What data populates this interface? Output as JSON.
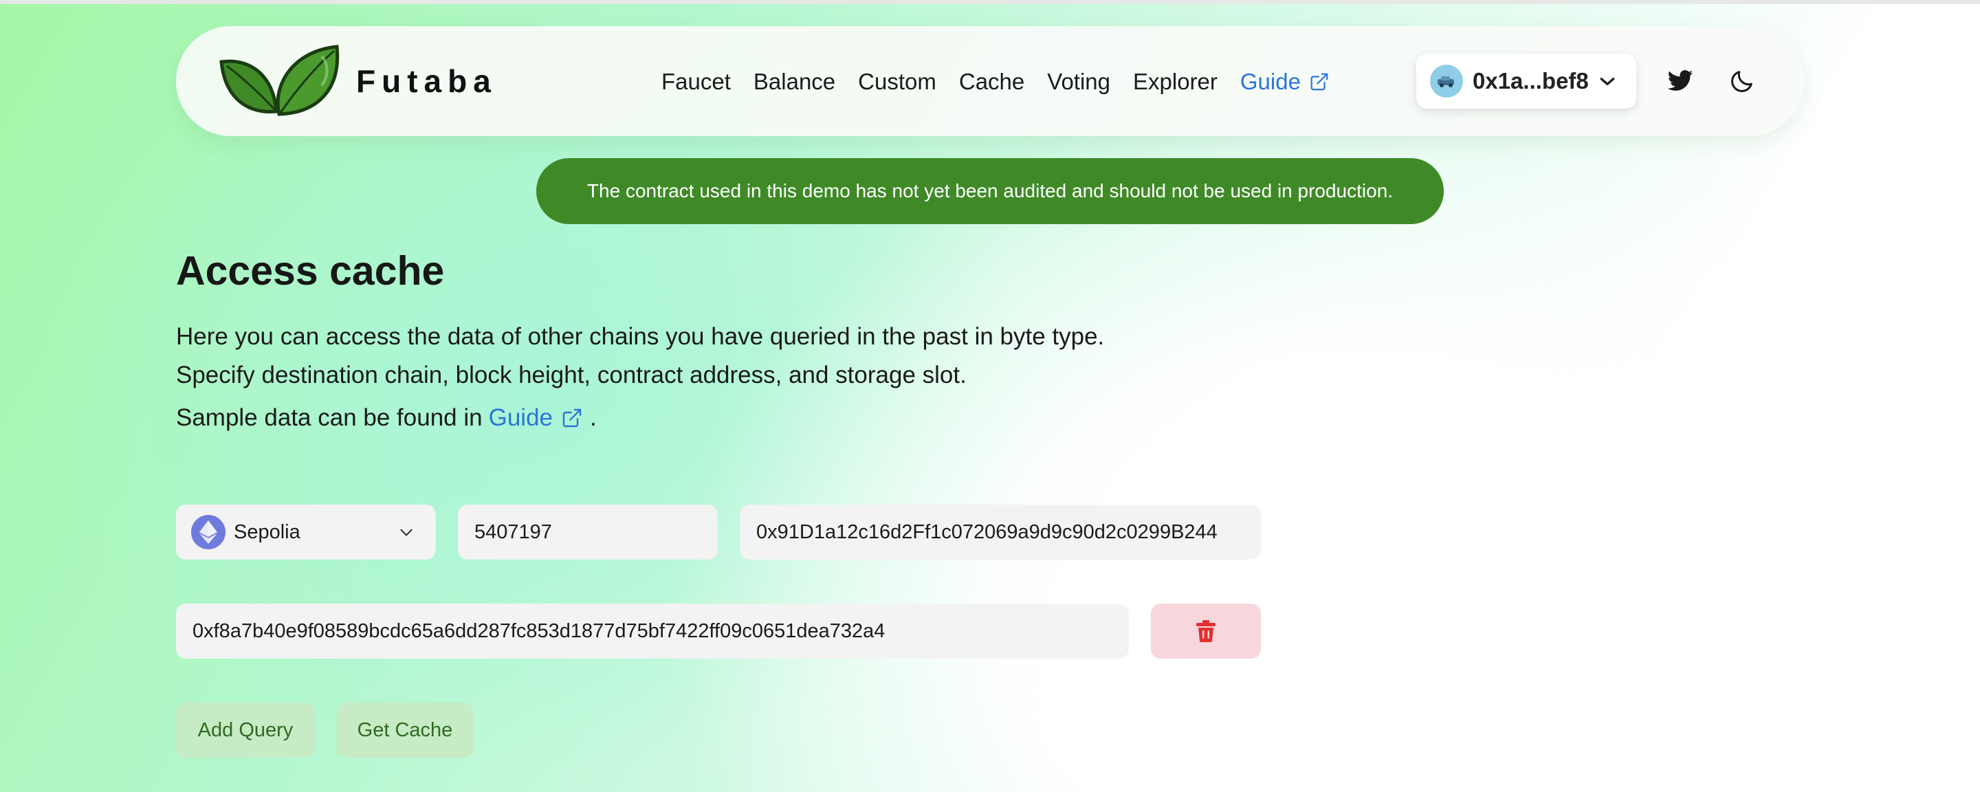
{
  "app": {
    "brand": "Futaba"
  },
  "nav": {
    "items": [
      "Faucet",
      "Balance",
      "Custom",
      "Cache",
      "Voting",
      "Explorer"
    ],
    "guide_label": "Guide"
  },
  "wallet": {
    "address": "0x1a...bef8"
  },
  "banner": {
    "text": "The contract used in this demo has not yet been audited and should not be used in production."
  },
  "page": {
    "title": "Access cache",
    "desc_line1": "Here you can access the data of other chains you have queried in the past in byte type.",
    "desc_line2": "Specify destination chain, block height, contract address, and storage slot.",
    "desc_line3_prefix": "Sample data can be found in",
    "desc_line3_link": "Guide",
    "desc_line3_suffix": "."
  },
  "form": {
    "chain": "Sepolia",
    "block_height": "5407197",
    "contract_address": "0x91D1a12c16d2Ff1c072069a9d9c90d2c0299B244",
    "storage_slot": "0xf8a7b40e9f08589bcdc65a6dd287fc853d1877d75bf7422ff09c0651dea732a4"
  },
  "buttons": {
    "add_query": "Add Query",
    "get_cache": "Get Cache"
  },
  "colors": {
    "banner_bg": "#3f8a27",
    "link": "#2b75d9",
    "delete_icon": "#e0312f",
    "button_bg": "#c7ebc4",
    "button_text": "#2f6b22"
  },
  "icons": {
    "logo": "leaf-logo-icon",
    "external": "external-link-icon",
    "wallet_avatar": "wallet-avatar-icon",
    "wallet_dropdown": "chevron-down-icon",
    "twitter": "twitter-icon",
    "theme": "moon-icon",
    "chain": "ethereum-icon",
    "delete": "trash-icon"
  }
}
